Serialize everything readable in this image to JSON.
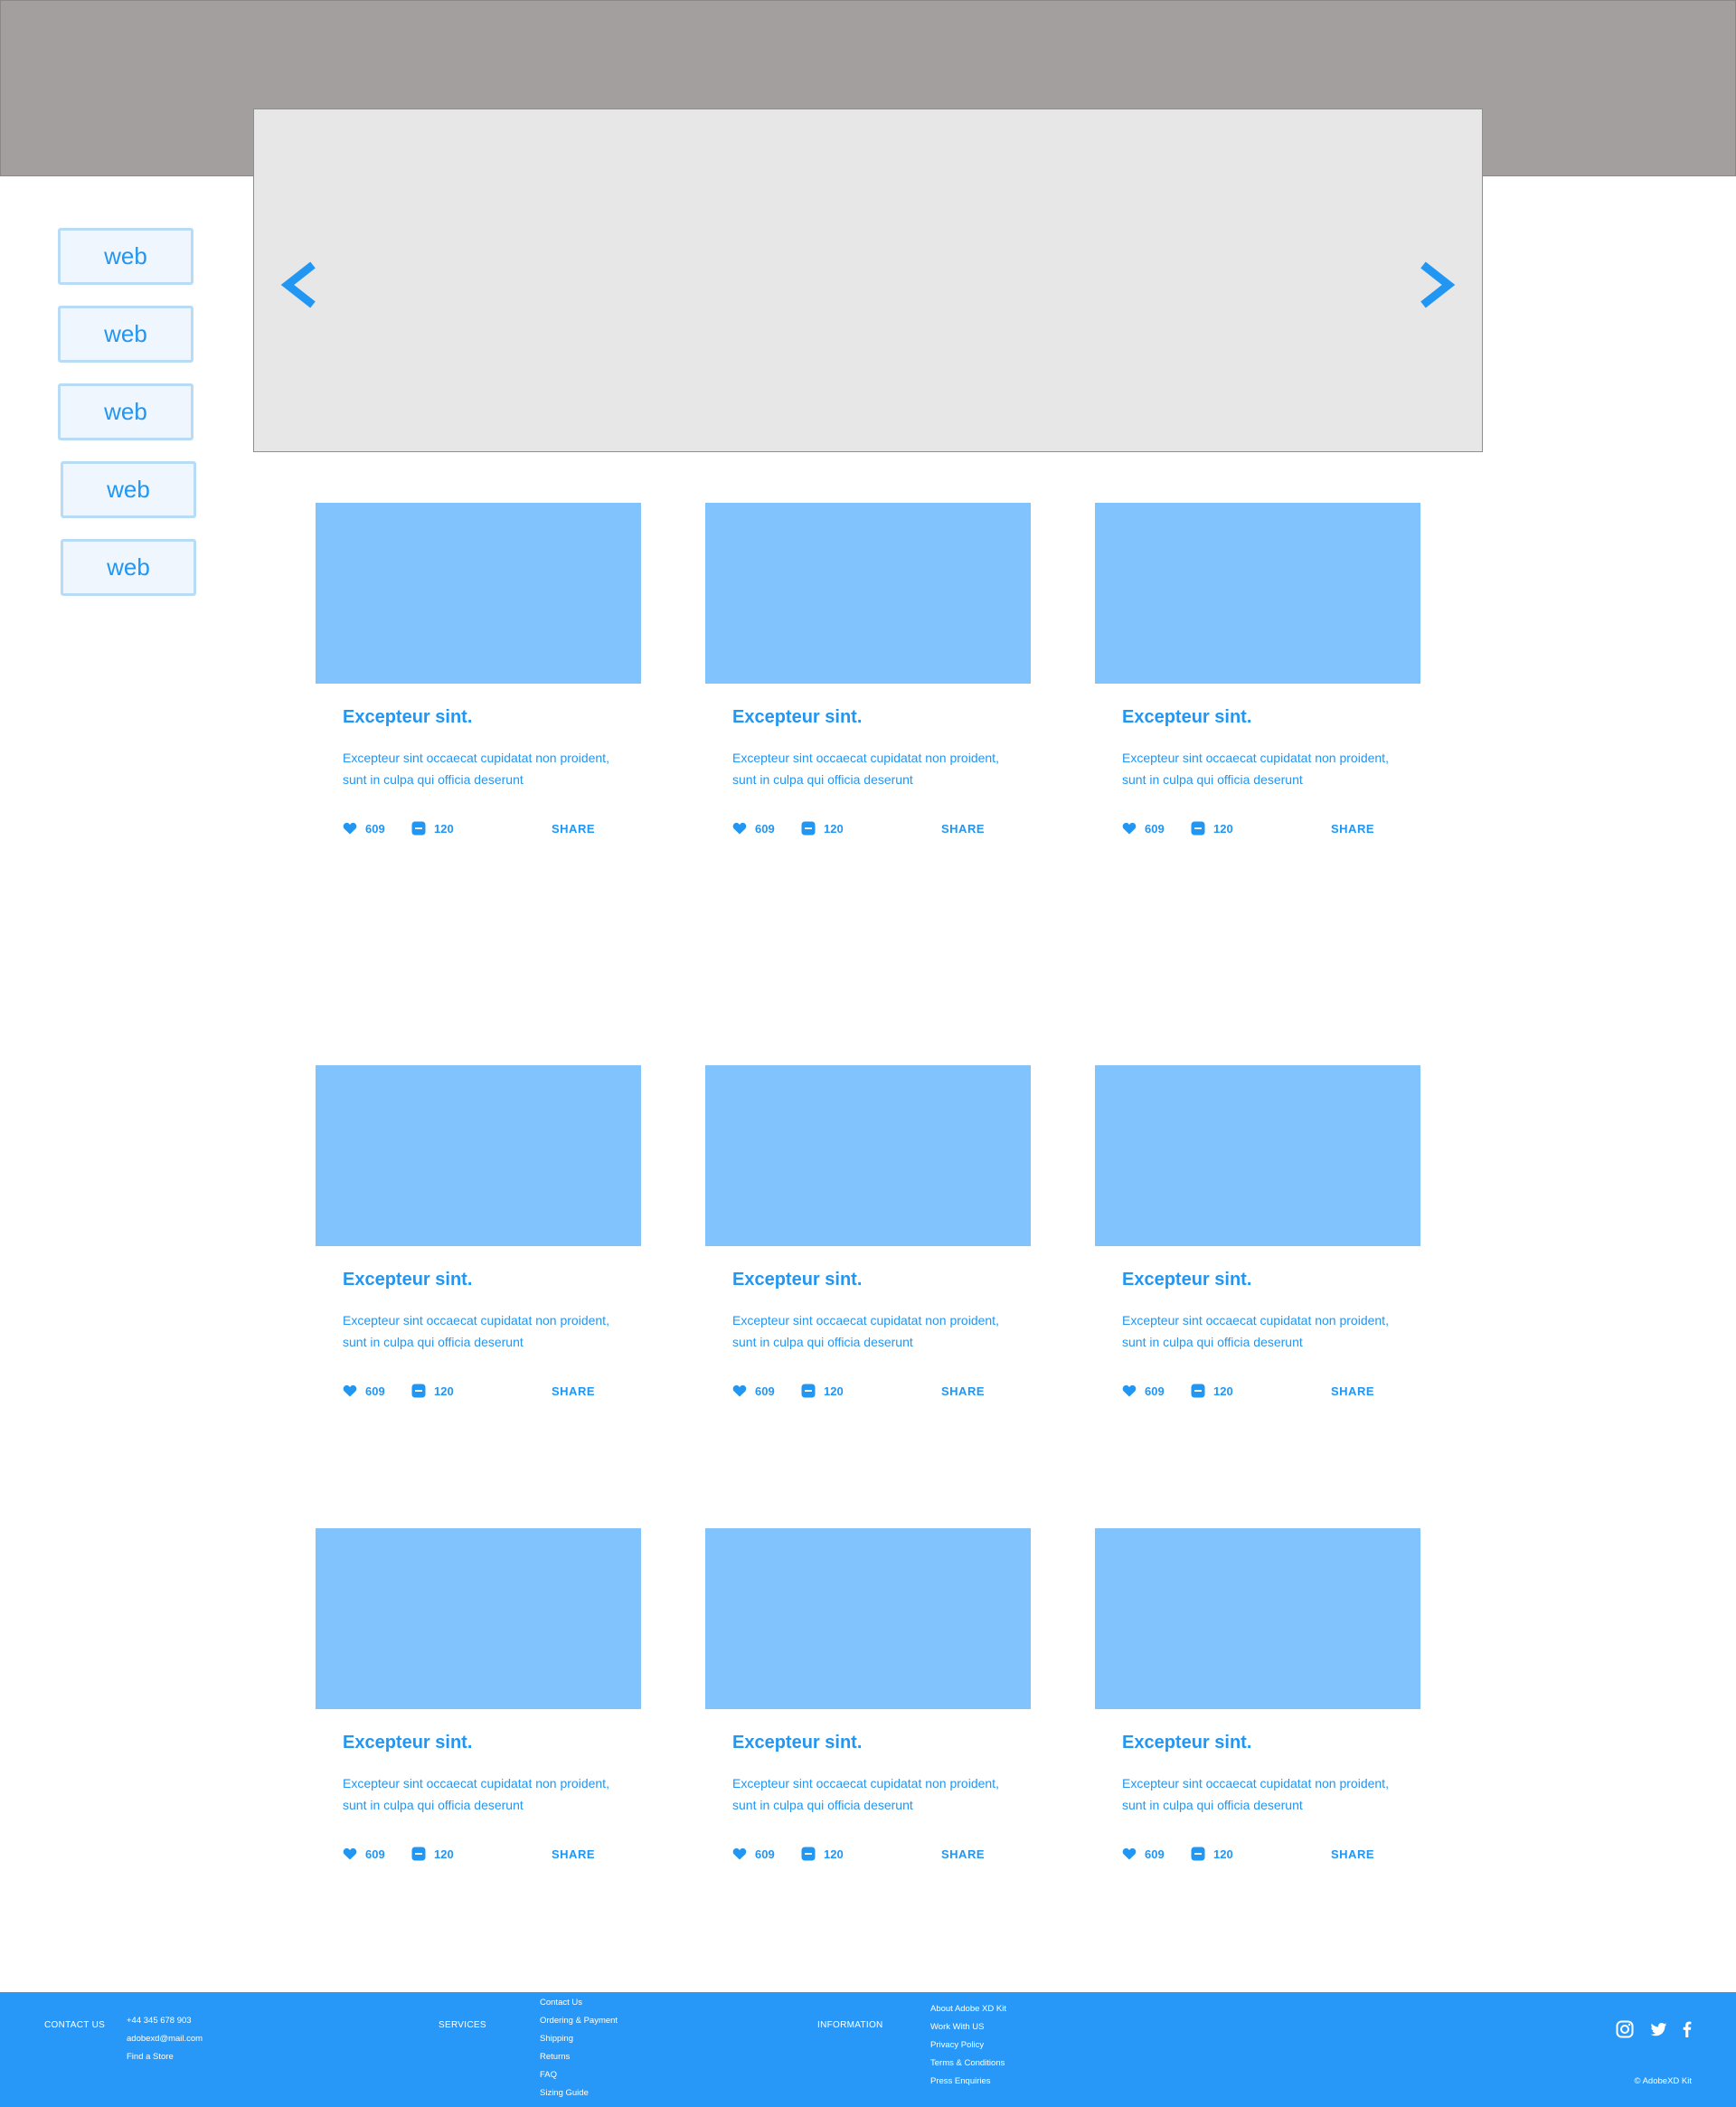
{
  "side_nav": {
    "items": [
      {
        "label": "web"
      },
      {
        "label": "web"
      },
      {
        "label": "web"
      },
      {
        "label": "web"
      },
      {
        "label": "web"
      }
    ]
  },
  "hero": {
    "prev_icon": "chevron-left-icon",
    "next_icon": "chevron-right-icon"
  },
  "cards": [
    {
      "title": "Excepteur sint.",
      "desc": "Excepteur sint occaecat cupidatat non proident, sunt in culpa qui officia deserunt",
      "likes": "609",
      "comments": "120",
      "share": "SHARE"
    },
    {
      "title": "Excepteur sint.",
      "desc": "Excepteur sint occaecat cupidatat non proident, sunt in culpa qui officia deserunt",
      "likes": "609",
      "comments": "120",
      "share": "SHARE"
    },
    {
      "title": "Excepteur sint.",
      "desc": "Excepteur sint occaecat cupidatat non proident, sunt in culpa qui officia deserunt",
      "likes": "609",
      "comments": "120",
      "share": "SHARE"
    },
    {
      "title": "Excepteur sint.",
      "desc": "Excepteur sint occaecat cupidatat non proident, sunt in culpa qui officia deserunt",
      "likes": "609",
      "comments": "120",
      "share": "SHARE"
    },
    {
      "title": "Excepteur sint.",
      "desc": "Excepteur sint occaecat cupidatat non proident, sunt in culpa qui officia deserunt",
      "likes": "609",
      "comments": "120",
      "share": "SHARE"
    },
    {
      "title": "Excepteur sint.",
      "desc": "Excepteur sint occaecat cupidatat non proident, sunt in culpa qui officia deserunt",
      "likes": "609",
      "comments": "120",
      "share": "SHARE"
    },
    {
      "title": "Excepteur sint.",
      "desc": "Excepteur sint occaecat cupidatat non proident, sunt in culpa qui officia deserunt",
      "likes": "609",
      "comments": "120",
      "share": "SHARE"
    },
    {
      "title": "Excepteur sint.",
      "desc": "Excepteur sint occaecat cupidatat non proident, sunt in culpa qui officia deserunt",
      "likes": "609",
      "comments": "120",
      "share": "SHARE"
    },
    {
      "title": "Excepteur sint.",
      "desc": "Excepteur sint occaecat cupidatat non proident, sunt in culpa qui officia deserunt",
      "likes": "609",
      "comments": "120",
      "share": "SHARE"
    }
  ],
  "footer": {
    "contact_heading": "CONTACT US",
    "contact_items": [
      "+44 345 678 903",
      "adobexd@mail.com",
      "Find a Store"
    ],
    "services_heading": "SERVICES",
    "services_items": [
      "Contact Us",
      "Ordering & Payment",
      "Shipping",
      "Returns",
      "FAQ",
      "Sizing Guide"
    ],
    "info_heading": "INFORMATION",
    "info_items": [
      "About Adobe XD Kit",
      "Work With US",
      "Privacy Policy",
      "Terms & Conditions",
      "Press Enquiries"
    ],
    "social_icons": [
      "instagram-icon",
      "twitter-icon",
      "facebook-icon"
    ],
    "copyright": "© AdobeXD Kit"
  },
  "colors": {
    "header_band": "#a29f9e",
    "hero_bg": "#e7e7e7",
    "accent": "#2196f3",
    "card_image": "#80c3fd",
    "footer_bg": "#2898f8"
  }
}
